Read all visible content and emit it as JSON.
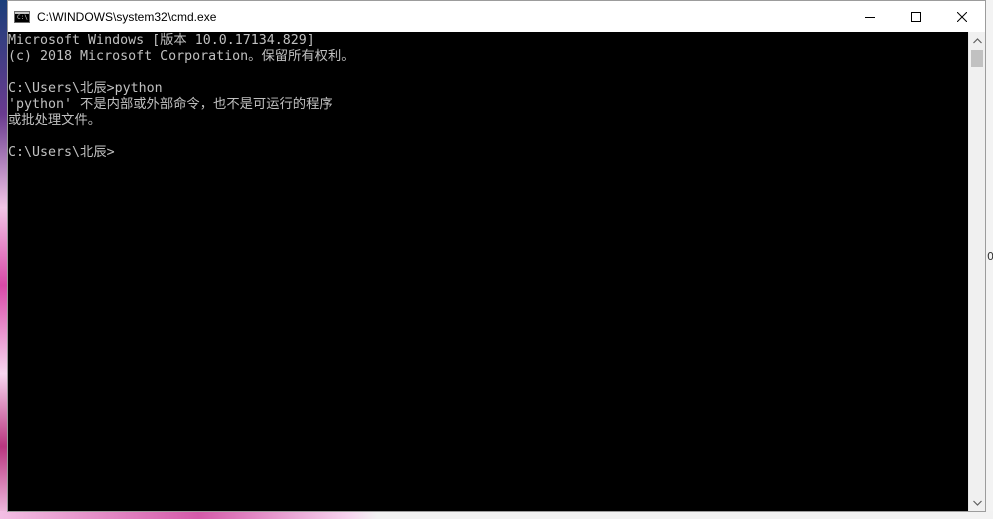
{
  "window": {
    "title": "C:\\WINDOWS\\system32\\cmd.exe",
    "app_icon_text": "C:\\",
    "colors": {
      "console_bg": "#000000",
      "console_text": "#c0c0c0",
      "titlebar_bg": "#ffffff"
    }
  },
  "caption_buttons": {
    "minimize_icon": "minimize-icon",
    "maximize_icon": "maximize-icon",
    "close_icon": "close-icon"
  },
  "console": {
    "lines": [
      "Microsoft Windows [版本 10.0.17134.829]",
      "(c) 2018 Microsoft Corporation。保留所有权利。",
      "",
      "C:\\Users\\北辰>python",
      "'python' 不是内部或外部命令，也不是可运行的程序",
      "或批处理文件。",
      "",
      "C:\\Users\\北辰>"
    ]
  },
  "desktop": {
    "right_edge_text": "0"
  }
}
